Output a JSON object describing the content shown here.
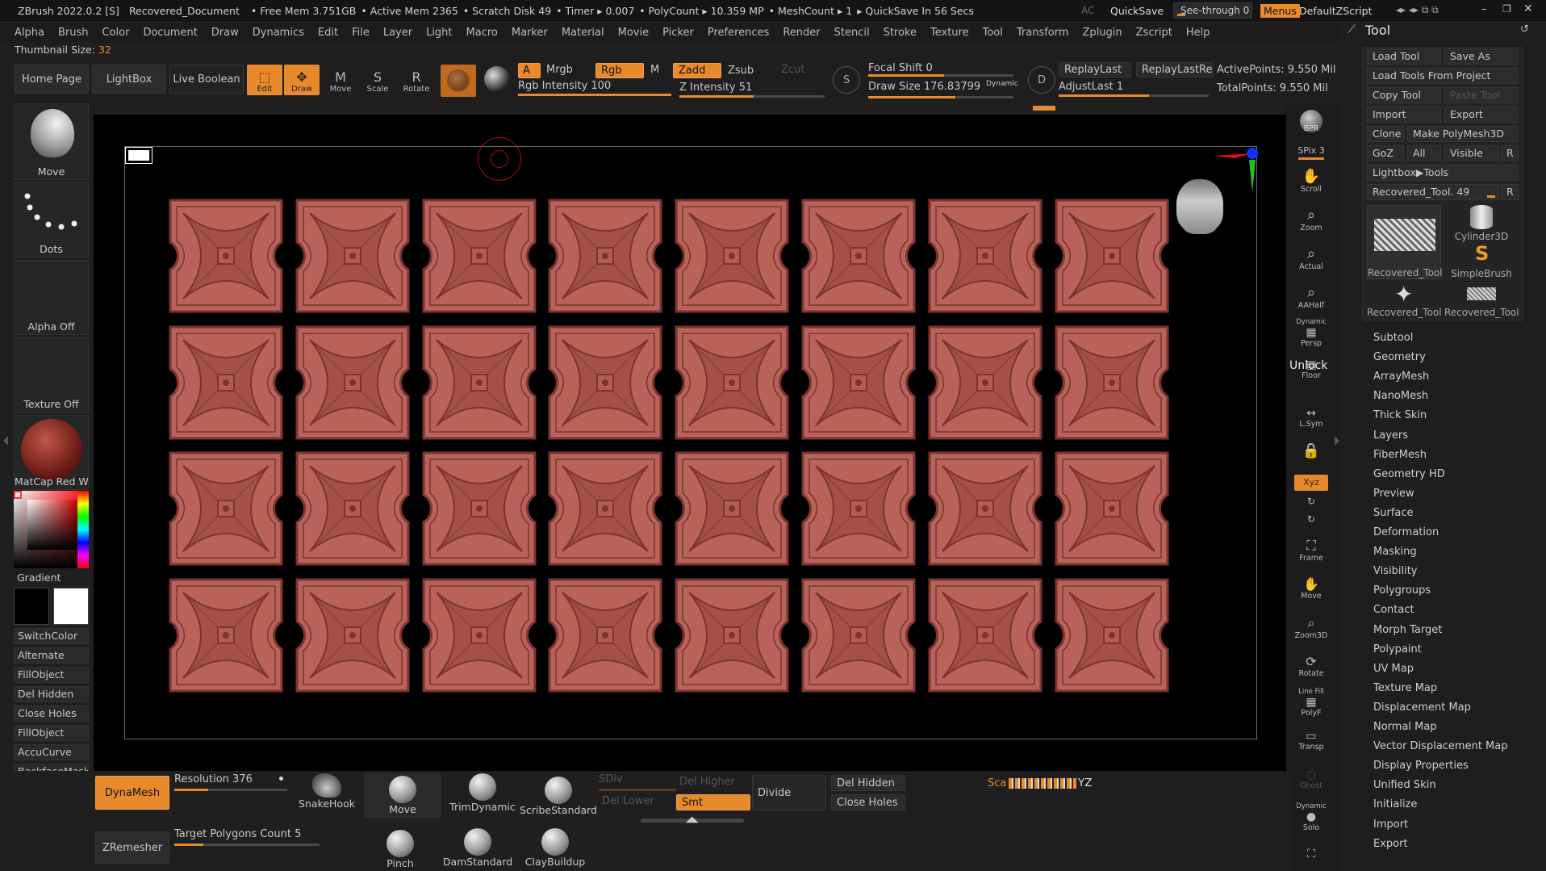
{
  "titlebar": {
    "app": "ZBrush 2022.0.2 [S]",
    "document": "Recovered_Document",
    "free_mem": "• Free Mem 3.751GB",
    "active_mem": "• Active Mem 2365",
    "scratch": "• Scratch Disk 49",
    "timer": "• Timer ▸ 0.007",
    "polycount": "• PolyCount ▸ 10.359 MP",
    "meshcount": "• MeshCount ▸ 1",
    "quicksave": "▸ QuickSave In 56 Secs",
    "ac": "AC",
    "quicksave_btn": "QuickSave",
    "seethrough": "See-through  0",
    "menus": "Menus",
    "script": "DefaultZScript"
  },
  "menubar": [
    "Alpha",
    "Brush",
    "Color",
    "Document",
    "Draw",
    "Dynamics",
    "Edit",
    "File",
    "Layer",
    "Light",
    "Macro",
    "Marker",
    "Material",
    "Movie",
    "Picker",
    "Preferences",
    "Render",
    "Stencil",
    "Stroke",
    "Texture",
    "Tool",
    "Transform",
    "Zplugin",
    "Zscript",
    "Help"
  ],
  "thumbnail": {
    "label": "Thumbnail Size:",
    "value": "32"
  },
  "toolbar": {
    "home": "Home Page",
    "lightbox": "LightBox",
    "live_boolean": "Live Boolean",
    "edit": "Edit",
    "draw": "Draw",
    "move": "Move",
    "scale": "Scale",
    "rotate": "Rotate",
    "a": "A",
    "mrgb": "Mrgb",
    "rgb": "Rgb",
    "m": "M",
    "zadd": "Zadd",
    "zsub": "Zsub",
    "zcut": "Zcut",
    "rgb_intensity": "Rgb Intensity 100",
    "z_intensity": "Z Intensity 51",
    "focal_shift": "Focal Shift 0",
    "draw_size": "Draw Size 176.83799",
    "dynamic": "Dynamic",
    "replay_last": "ReplayLast",
    "replay_last_rel": "ReplayLastRel",
    "adjust_last": "AdjustLast 1",
    "active_points": "ActivePoints: 9.550 Mil",
    "total_points": "TotalPoints: 9.550 Mil",
    "rgb_intensity_value": 100,
    "z_intensity_value": 51
  },
  "leftshelf": {
    "brush": "Move",
    "stroke": "Dots",
    "alpha": "Alpha Off",
    "texture": "Texture Off",
    "material": "MatCap Red Wax",
    "gradient": "Gradient",
    "buttons": [
      "SwitchColor",
      "Alternate",
      "FillObject",
      "Del Hidden",
      "Close Holes",
      "FillObject",
      "AccuCurve",
      "BackfaceMask"
    ]
  },
  "rightshelf": [
    "BPR",
    "SPix 3",
    "Scroll",
    "Zoom",
    "Actual",
    "AAHalf",
    "Persp",
    "Floor",
    "L.Sym",
    "Lock",
    "Xyz",
    "Frame",
    "Move",
    "Zoom3D",
    "Rotate",
    "PolyF",
    "Transp",
    "Ghost",
    "Solo"
  ],
  "rightshelf_extra": {
    "line_fill": "Line Fill",
    "unlock_overlay": "Unlock",
    "dynamic": "Dynamic"
  },
  "toolpanel": {
    "title": "Tool",
    "load_tool": "Load Tool",
    "save_as": "Save As",
    "load_tools_from_project": "Load Tools From Project",
    "copy_tool": "Copy Tool",
    "paste_tool": "Paste Tool",
    "import": "Import",
    "export": "Export",
    "clone": "Clone",
    "make_polymesh": "Make PolyMesh3D",
    "goz": "GoZ",
    "all": "All",
    "visible": "Visible",
    "r": "R",
    "lightbox_tools": "Lightbox▶Tools",
    "current_tool": "Recovered_Tool. 49",
    "thumbs": [
      "Recovered_Tool",
      "Cylinder3D",
      "SimpleBrush",
      "Recovered_Tool",
      "Recovered_Tool"
    ],
    "sections": [
      "Subtool",
      "Geometry",
      "ArrayMesh",
      "NanoMesh",
      "Thick Skin",
      "Layers",
      "FiberMesh",
      "Geometry HD",
      "Preview",
      "Surface",
      "Deformation",
      "Masking",
      "Visibility",
      "Polygroups",
      "Contact",
      "Morph Target",
      "Polypaint",
      "UV Map",
      "Texture Map",
      "Displacement Map",
      "Normal Map",
      "Vector Displacement Map",
      "Display Properties",
      "Unified Skin",
      "Initialize",
      "Import",
      "Export"
    ]
  },
  "bottombar": {
    "dynamesh": "DynaMesh",
    "resolution": "Resolution 376",
    "zremesher": "ZRemesher",
    "target_polys": "Target Polygons Count 5",
    "brushes": [
      "SnakeHook",
      "Move",
      "TrimDynamic",
      "ScribeStandard",
      "Pinch",
      "DamStandard",
      "ClayBuildup"
    ],
    "sdiv": "SDiv",
    "del_higher": "Del Higher",
    "del_lower": "Del Lower",
    "smt": "Smt",
    "divide": "Divide",
    "del_hidden": "Del Hidden",
    "close_holes": "Close Holes",
    "overlay_text": "Sca",
    "yz": "YZ"
  },
  "colors": {
    "accent": "#e88a2c",
    "tile": "#b8625a",
    "tile_dark": "#7a3530"
  }
}
